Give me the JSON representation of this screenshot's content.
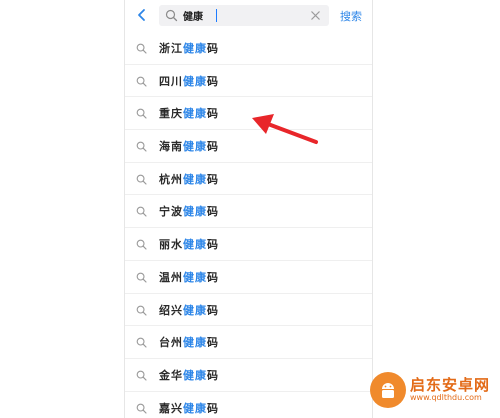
{
  "header": {
    "search_value": "健康",
    "search_action_label": "搜索"
  },
  "suggestions": [
    {
      "city": "浙江",
      "keyword": "健康",
      "suffix": "码"
    },
    {
      "city": "四川",
      "keyword": "健康",
      "suffix": "码"
    },
    {
      "city": "重庆",
      "keyword": "健康",
      "suffix": "码"
    },
    {
      "city": "海南",
      "keyword": "健康",
      "suffix": "码"
    },
    {
      "city": "杭州",
      "keyword": "健康",
      "suffix": "码"
    },
    {
      "city": "宁波",
      "keyword": "健康",
      "suffix": "码"
    },
    {
      "city": "丽水",
      "keyword": "健康",
      "suffix": "码"
    },
    {
      "city": "温州",
      "keyword": "健康",
      "suffix": "码"
    },
    {
      "city": "绍兴",
      "keyword": "健康",
      "suffix": "码"
    },
    {
      "city": "台州",
      "keyword": "健康",
      "suffix": "码"
    },
    {
      "city": "金华",
      "keyword": "健康",
      "suffix": "码"
    },
    {
      "city": "嘉兴",
      "keyword": "健康",
      "suffix": "码"
    }
  ],
  "watermark": {
    "title": "启东安卓网",
    "url": "www.qdlthdu.com"
  },
  "icons": {
    "back": "chevron-left-icon",
    "search": "search-icon",
    "clear": "close-icon",
    "annotation": "red-arrow-icon"
  },
  "colors": {
    "accent": "#2d86e8",
    "arrow": "#e8262a",
    "watermark": "#e36b18"
  }
}
